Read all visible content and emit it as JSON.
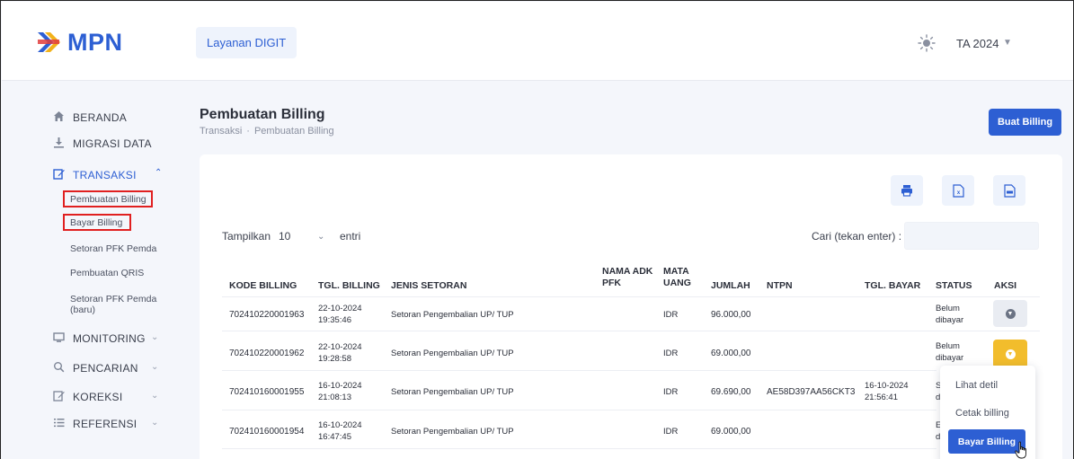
{
  "header": {
    "logo_text": "MPN",
    "app_name": "Layanan DIGIT",
    "year_label": "TA 2024",
    "brand_color": "#2d5fd3",
    "icons": {
      "logo": "mpn-logo-icon",
      "theme": "sun-icon",
      "caret": "chevron-down-icon"
    }
  },
  "sidebar": {
    "items": [
      {
        "label": "BERANDA",
        "icon": "home-icon"
      },
      {
        "label": "MIGRASI DATA",
        "icon": "download-icon"
      },
      {
        "label": "TRANSAKSI",
        "icon": "edit-icon",
        "active": true
      },
      {
        "label": "MONITORING",
        "icon": "monitor-icon"
      },
      {
        "label": "PENCARIAN",
        "icon": "search-icon"
      },
      {
        "label": "KOREKSI",
        "icon": "edit-icon"
      },
      {
        "label": "REFERENSI",
        "icon": "list-icon"
      }
    ],
    "transaksi_sub": [
      "Pembuatan Billing",
      "Bayar Billing",
      "Setoran PFK Pemda",
      "Pembuatan QRIS",
      "Setoran PFK Pemda",
      "(baru)"
    ],
    "caret_up": "^",
    "caret_down": "⌄"
  },
  "page": {
    "title": "Pembuatan Billing",
    "breadcrumb": [
      "Transaksi",
      "Pembuatan Billing"
    ],
    "create_button": "Buat Billing"
  },
  "toolbar": {
    "icons": [
      "print-icon",
      "excel-icon",
      "pdf-icon"
    ]
  },
  "table_controls": {
    "show_label": "Tampilkan",
    "page_size": "10",
    "entries_label": "entri",
    "search_label": "Cari (tekan enter) :"
  },
  "table": {
    "headers": {
      "kode": "KODE BILLING",
      "tgl": "TGL. BILLING",
      "jenis": "JENIS SETORAN",
      "adk1": "NAMA ADK",
      "adk2": "PFK",
      "mata1": "MATA",
      "mata2": "UANG",
      "jumlah": "JUMLAH",
      "ntpn": "NTPN",
      "tglbayar": "TGL. BAYAR",
      "status": "STATUS",
      "aksi": "AKSI"
    },
    "rows": [
      {
        "kode": "702410220001963",
        "tgl1": "22-10-2024",
        "tgl2": "19:35:46",
        "jenis": "Setoran Pengembalian UP/ TUP",
        "mata": "IDR",
        "jumlah": "96.000,00",
        "ntpn": "",
        "bayar1": "",
        "bayar2": "",
        "status1": "Belum",
        "status2": "dibayar"
      },
      {
        "kode": "702410220001962",
        "tgl1": "22-10-2024",
        "tgl2": "19:28:58",
        "jenis": "Setoran Pengembalian UP/ TUP",
        "mata": "IDR",
        "jumlah": "69.000,00",
        "ntpn": "",
        "bayar1": "",
        "bayar2": "",
        "status1": "Belum",
        "status2": "dibayar"
      },
      {
        "kode": "702410160001955",
        "tgl1": "16-10-2024",
        "tgl2": "21:08:13",
        "jenis": "Setoran Pengembalian UP/ TUP",
        "mata": "IDR",
        "jumlah": "69.690,00",
        "ntpn": "AE58D397AA56CKT3",
        "bayar1": "16-10-2024",
        "bayar2": "21:56:41",
        "status1": "S",
        "status2": "d"
      },
      {
        "kode": "702410160001954",
        "tgl1": "16-10-2024",
        "tgl2": "16:47:45",
        "jenis": "Setoran Pengembalian UP/ TUP",
        "mata": "IDR",
        "jumlah": "69.000,00",
        "ntpn": "",
        "bayar1": "",
        "bayar2": "",
        "status1": "E",
        "status2": "d"
      }
    ]
  },
  "action_menu": {
    "items": [
      "Lihat detil",
      "Cetak billing",
      "Bayar Billing"
    ]
  }
}
